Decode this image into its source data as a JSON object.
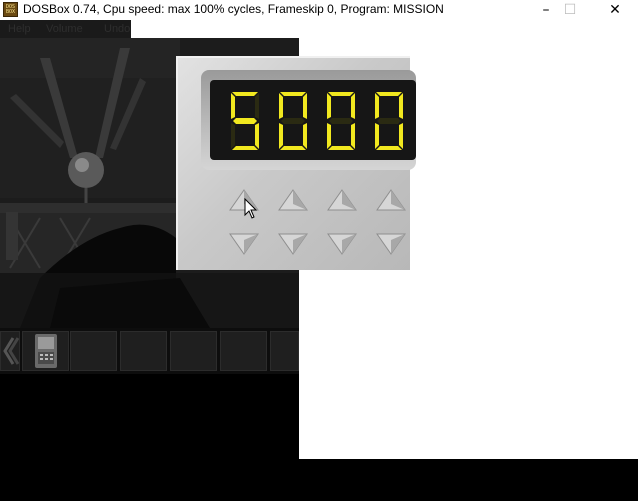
{
  "window": {
    "title": "DOSBox 0.74, Cpu speed: max 100% cycles, Frameskip  0, Program:  MISSION",
    "icon_label": "DOS BOX",
    "icon_name": "dosbox-app-icon",
    "controls": {
      "minimize": "–",
      "maximize": "☐",
      "close": "✕"
    }
  },
  "menu": {
    "items": [
      "Help",
      "Volume",
      "Undo"
    ]
  },
  "keypad": {
    "digits": [
      "5",
      "0",
      "0",
      "0"
    ],
    "digit_color": "#f1e81f",
    "up_icon": "triangle-up-icon",
    "down_icon": "triangle-down-icon"
  },
  "inventory": {
    "item_icon": "handheld-computer-icon",
    "back_icon": "chevron-left-icon"
  }
}
